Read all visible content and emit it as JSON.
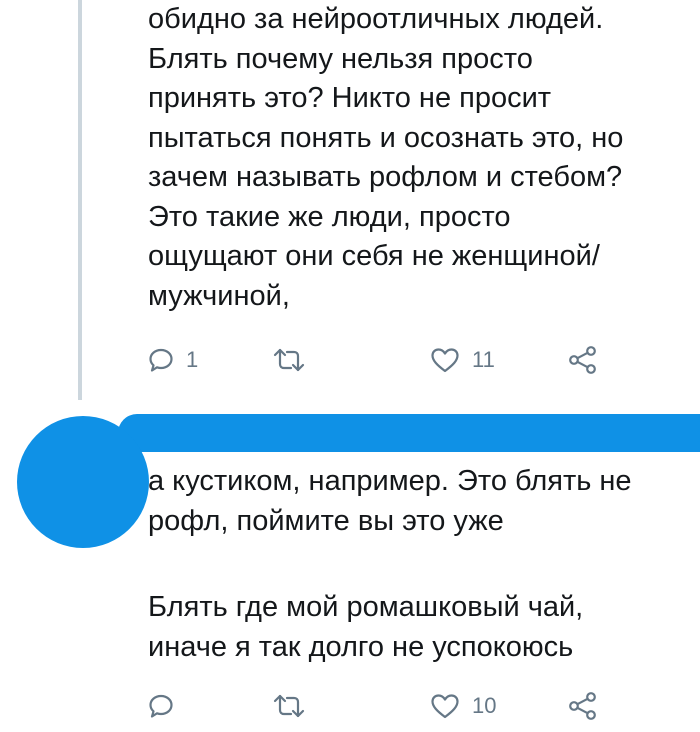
{
  "tweets": [
    {
      "text": "обидно за нейроотличных людей.\nБлять почему нельзя просто\nпринять это? Никто не просит\nпытаться понять и осознать это, но\nзачем называть рофлом и стебом?\nЭто такие же люди, просто\nощущают они себя не женщиной/\nмужчиной,",
      "actions": {
        "reply_icon": "reply-icon",
        "reply_count": "1",
        "retweet_icon": "retweet-icon",
        "retweet_count": "",
        "like_icon": "like-icon",
        "like_count": "11",
        "share_icon": "share-icon"
      }
    },
    {
      "text_part1": "а кустиком, например. Это блять не\nрофл, поймите вы это уже",
      "text_part2": "Блять где мой ромашковый чай,\nиначе я так долго не успокоюсь",
      "actions": {
        "reply_icon": "reply-icon",
        "reply_count": "",
        "retweet_icon": "retweet-icon",
        "retweet_count": "",
        "like_icon": "like-icon",
        "like_count": "10",
        "share_icon": "share-icon"
      }
    }
  ],
  "colors": {
    "text": "#14171a",
    "icon_gray": "#657786",
    "thread_line": "#ccd6dd",
    "redaction_blue": "#0f91e6"
  }
}
